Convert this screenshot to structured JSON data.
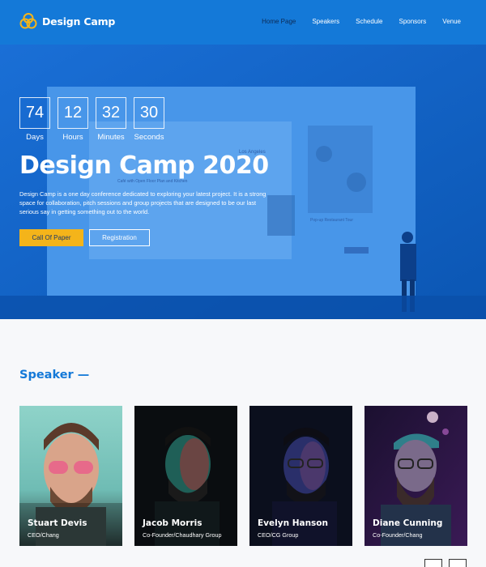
{
  "header": {
    "brand": "Design Camp",
    "nav": [
      {
        "label": "Home Page",
        "active": true
      },
      {
        "label": "Speakers",
        "active": false
      },
      {
        "label": "Schedule",
        "active": false
      },
      {
        "label": "Sponsors",
        "active": false
      },
      {
        "label": "Venue",
        "active": false
      }
    ]
  },
  "hero": {
    "countdown": [
      {
        "value": "74",
        "label": "Days"
      },
      {
        "value": "12",
        "label": "Hours"
      },
      {
        "value": "32",
        "label": "Minutes"
      },
      {
        "value": "30",
        "label": "Seconds"
      }
    ],
    "title": "Design Camp 2020",
    "description": "Design Camp is a one day conference dedicated to exploring your latest project. It is a strong space for collaboration, pitch sessions and group projects that are designed to be our last serious say in getting something out to the world.",
    "primary_button": "Call Of Paper",
    "secondary_button": "Registration",
    "screen_texts": {
      "city": "Los Angeles",
      "tour_title": "Pop-up Restaurant Tour",
      "card_text": "Café with Open Floor Plan and Kitchen"
    }
  },
  "speakers": {
    "title": "Speaker —",
    "items": [
      {
        "name": "Stuart Devis",
        "role": "CEO/Chang"
      },
      {
        "name": "Jacob Morris",
        "role": "Co-Founder/Chaudhary Group"
      },
      {
        "name": "Evelyn Hanson",
        "role": "CEO/CG Group"
      },
      {
        "name": "Diane Cunning",
        "role": "Co-Founder/Chang"
      }
    ]
  },
  "colors": {
    "primary": "#1479d8",
    "accent": "#f4b41a",
    "active_nav": "#0d2b55"
  }
}
